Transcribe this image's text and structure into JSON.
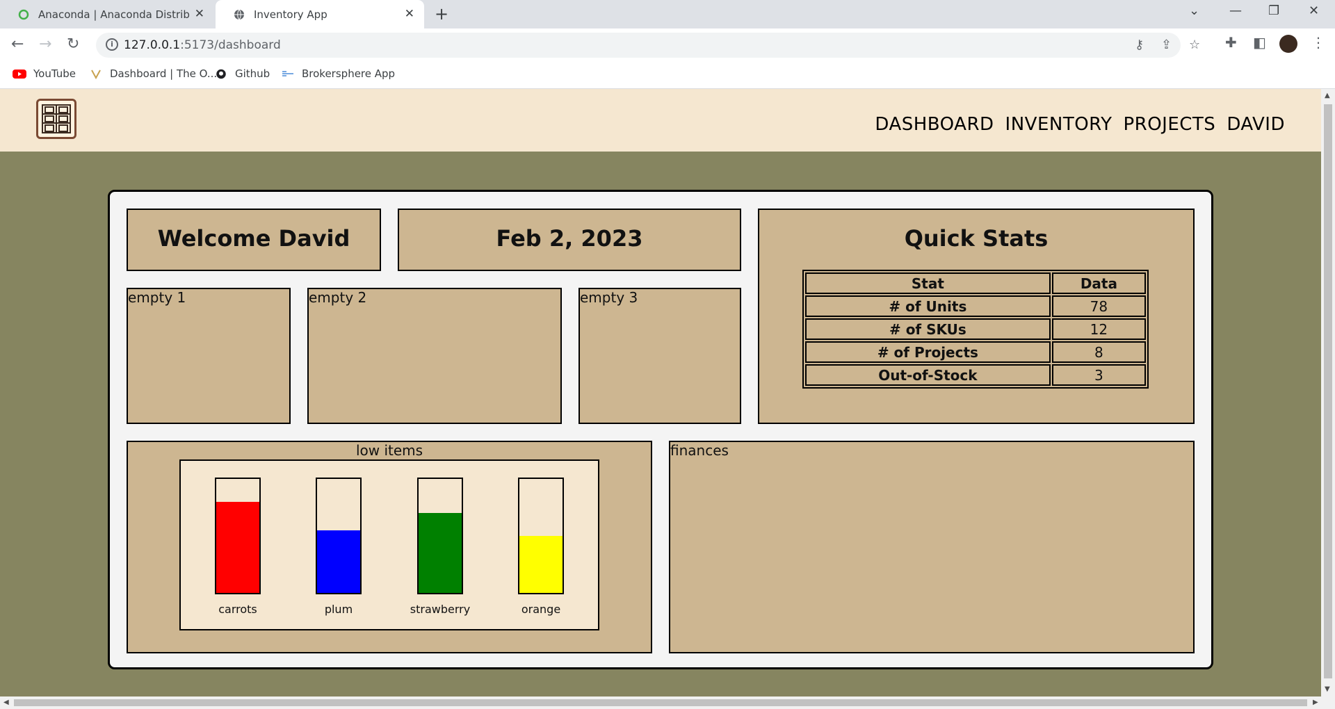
{
  "browser": {
    "tabs": [
      {
        "title": "Anaconda | Anaconda Distribution",
        "active": false
      },
      {
        "title": "Inventory App",
        "active": true
      }
    ],
    "url_host": "127.0.0.1",
    "url_path": ":5173/dashboard",
    "bookmarks": [
      "YouTube",
      "Dashboard | The O...",
      "Github",
      "Brokersphere App"
    ]
  },
  "nav": {
    "links": [
      "DASHBOARD",
      "INVENTORY",
      "PROJECTS",
      "DAVID"
    ]
  },
  "dashboard": {
    "welcome": "Welcome David",
    "date": "Feb 2, 2023",
    "empty_panels": [
      "empty 1",
      "empty 2",
      "empty 3"
    ],
    "quick_stats": {
      "title": "Quick Stats",
      "headers": [
        "Stat",
        "Data"
      ],
      "rows": [
        [
          "# of Units",
          "78"
        ],
        [
          "# of SKUs",
          "12"
        ],
        [
          "# of Projects",
          "8"
        ],
        [
          "Out-of-Stock",
          "3"
        ]
      ]
    },
    "low_items_title": "low items",
    "finances_title": "finances"
  },
  "chart_data": {
    "type": "bar",
    "categories": [
      "carrots",
      "plum",
      "strawberry",
      "orange"
    ],
    "values": [
      0.8,
      0.55,
      0.7,
      0.5
    ],
    "colors": [
      "#ff0000",
      "#0000ff",
      "#008000",
      "#ffff00"
    ],
    "ylim": [
      0,
      1
    ]
  }
}
